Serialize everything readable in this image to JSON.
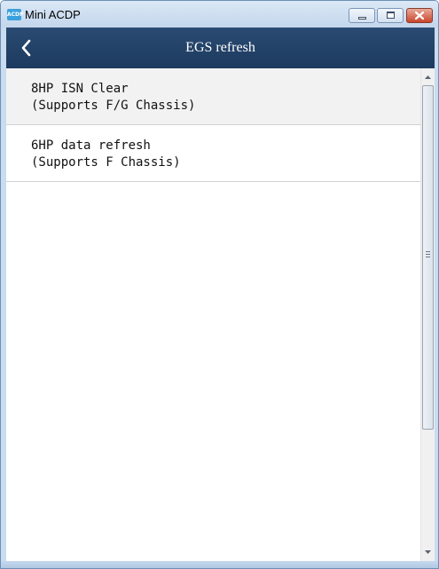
{
  "window": {
    "title": "Mini ACDP",
    "icon_text": "ACDP"
  },
  "header": {
    "title": "EGS refresh",
    "back_icon": "chevron-left-icon"
  },
  "items": [
    {
      "line1": "8HP ISN Clear",
      "line2": "(Supports F/G Chassis)",
      "selected": true
    },
    {
      "line1": "6HP data refresh",
      "line2": "(Supports F Chassis)",
      "selected": false
    }
  ],
  "colors": {
    "header_bg": "#1d3a5f",
    "selected_row_bg": "#f2f2f2",
    "frame": "#c9dcf0"
  }
}
